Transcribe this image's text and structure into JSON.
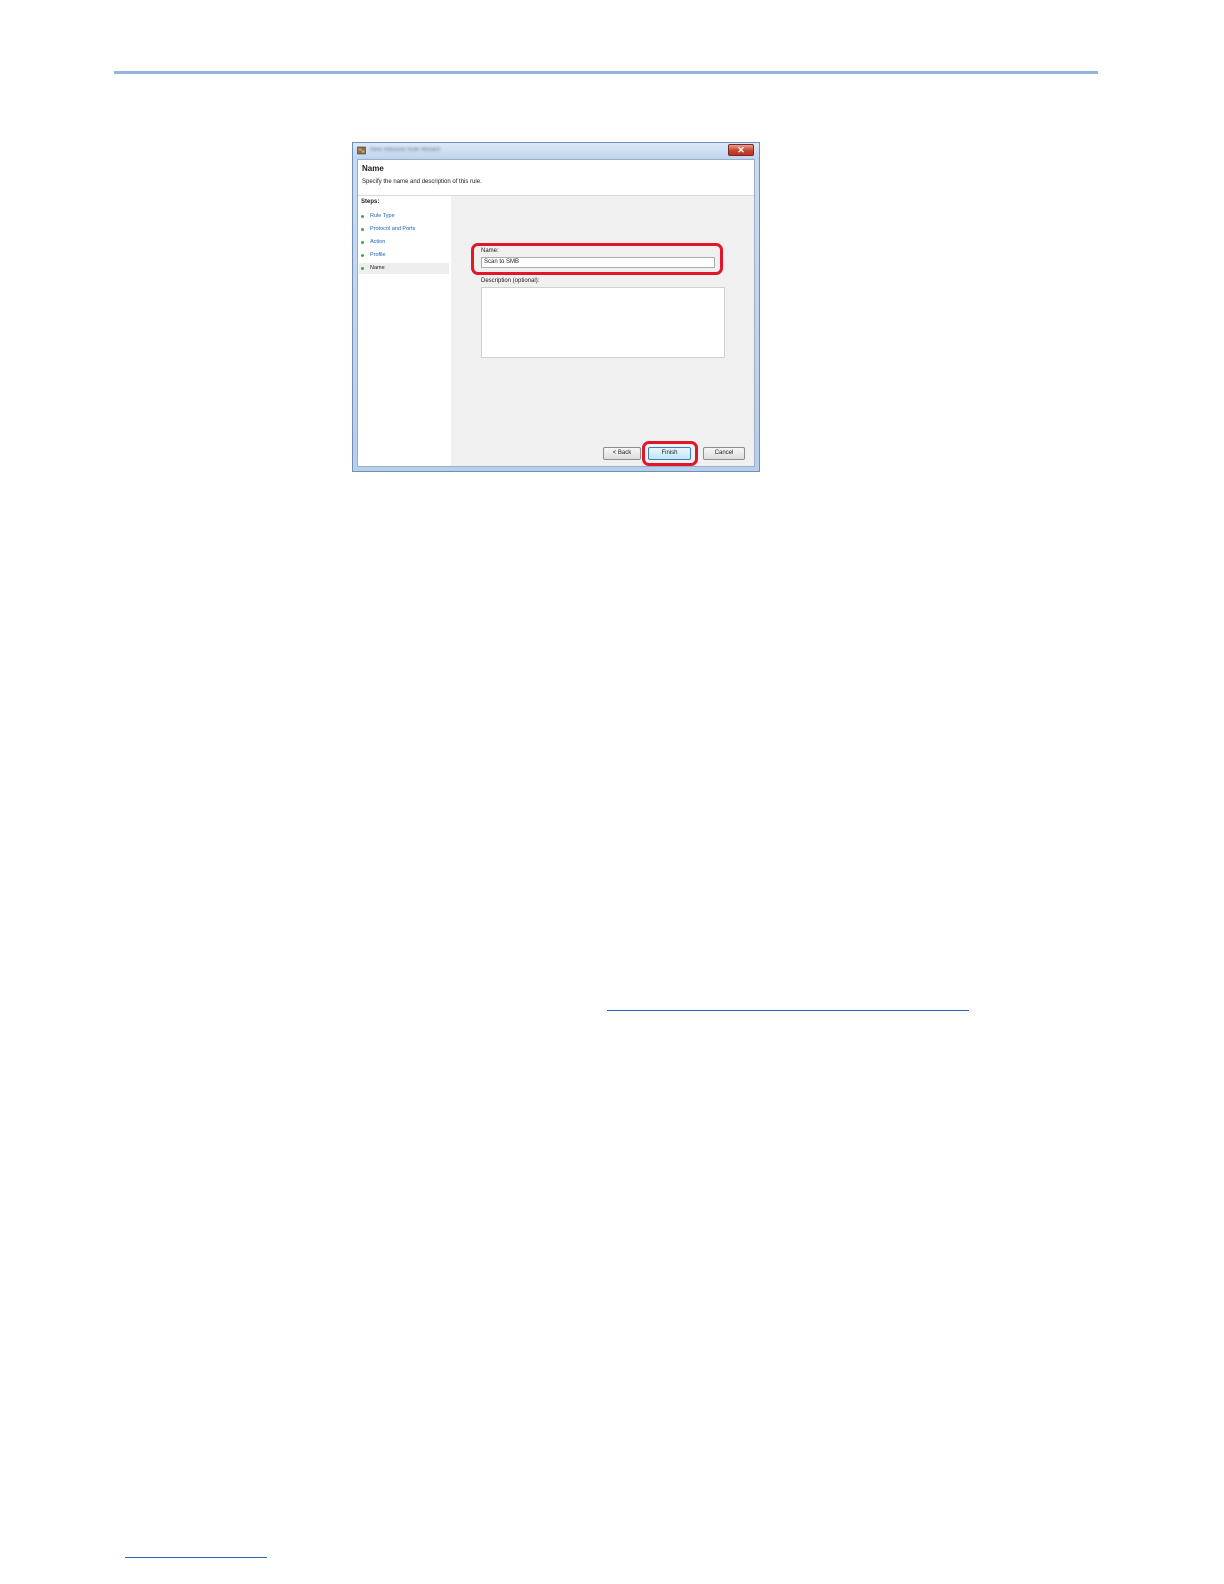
{
  "window": {
    "title": "New Inbound Rule Wizard",
    "close_glyph": "✕"
  },
  "header": {
    "heading": "Name",
    "subheading": "Specify the name and description of this rule."
  },
  "steps": {
    "label": "Steps:",
    "items": [
      {
        "label": "Rule Type"
      },
      {
        "label": "Protocol and Ports"
      },
      {
        "label": "Action"
      },
      {
        "label": "Profile"
      },
      {
        "label": "Name"
      }
    ],
    "current": "Name"
  },
  "form": {
    "name_label": "Name:",
    "name_value": "Scan to SMB",
    "description_label": "Description (optional):",
    "description_value": ""
  },
  "buttons": {
    "back": "< Back",
    "finish": "Finish",
    "cancel": "Cancel"
  },
  "colors": {
    "highlight": "#e0162b",
    "step_link": "#1a5fb4",
    "step_dot": "#46a83a",
    "rule": "#8fb4e3"
  },
  "icons": {
    "window_icon": "firewall-wizard-icon",
    "step_bullet": "green-dot-icon"
  }
}
